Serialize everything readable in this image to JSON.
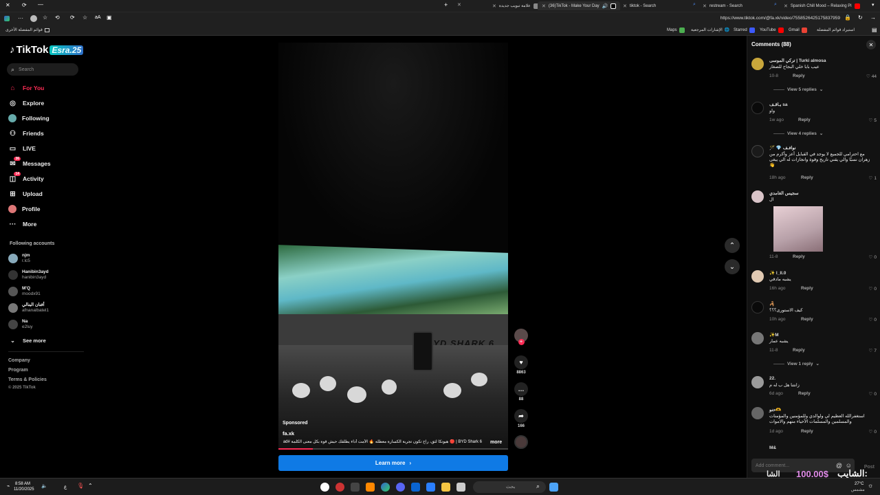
{
  "browser": {
    "tabs": [
      {
        "label": "Spanish Chill Mood – Relaxing Pl",
        "active": false
      },
      {
        "label": "restream - Search",
        "active": false
      },
      {
        "label": "tiktok - Search",
        "active": false
      },
      {
        "label": "(36)TikTok - Make Your Day",
        "active": true
      },
      {
        "label": "علامة تبويب جديدة",
        "active": false
      }
    ],
    "url": "https://www.tiktok.com/@fa.xk/video/7558526425175837959",
    "bookmarks": {
      "other": "قوائم المفضلة الأخرى",
      "import": "استيراد قوائم المفضلة",
      "gmail": "Gmail",
      "youtube": "YouTube",
      "starred": "Starred",
      "refs": "الإشارات المرجعية",
      "maps": "Maps"
    }
  },
  "sidebar": {
    "logo_text": "TikTok",
    "logo_badge": "Esra.25",
    "search_placeholder": "Search",
    "nav": [
      {
        "label": "For You",
        "icon": "home-icon",
        "active": true
      },
      {
        "label": "Explore",
        "icon": "compass-icon"
      },
      {
        "label": "Following",
        "icon": "following-icon"
      },
      {
        "label": "Friends",
        "icon": "friends-icon"
      },
      {
        "label": "LIVE",
        "icon": "live-icon"
      },
      {
        "label": "Messages",
        "icon": "messages-icon",
        "badge": "36"
      },
      {
        "label": "Activity",
        "icon": "activity-icon",
        "badge": "14"
      },
      {
        "label": "Upload",
        "icon": "upload-icon"
      },
      {
        "label": "Profile",
        "icon": "profile-icon"
      },
      {
        "label": "More",
        "icon": "more-icon"
      }
    ],
    "following_title": "Following accounts",
    "accounts": [
      {
        "name": "njm",
        "username": "r.lc5"
      },
      {
        "name": "Hanibin3ayd",
        "username": "hanibin3ayd"
      },
      {
        "name": "M'Q",
        "username": "moodx91"
      },
      {
        "name": "أفنان البنالي",
        "username": "afnanalbatel1"
      },
      {
        "name": "Na",
        "username": "e2luy"
      }
    ],
    "see_more": "See more",
    "footer": [
      "Company",
      "Program",
      "Terms & Policies",
      "© 2025 TikTok"
    ]
  },
  "video": {
    "sponsored": "Sponsored",
    "author": "fa.xk",
    "caption": "BYD Shark 6 | 🔴 هيونكا لثق، راح تكون تجربة الكسارة معطله 🔥 الأمت أداء يطلقك حيش قوة بكل معنى الكلمة #ad ...",
    "more": "more",
    "wall_brand": "BYD SHARK 6",
    "progress": 0.15,
    "likes": "8863",
    "comments": "88",
    "shares": "166",
    "learn_more": "Learn more"
  },
  "comments": {
    "title": "Comments (88)",
    "items": [
      {
        "user": "تركي الموسى | Turki almosa",
        "text": "عيب بابا خلي البجاح للصغار",
        "time": "10-8",
        "likes": "44",
        "view_replies": "View 5 replies"
      },
      {
        "user": "ﺑـﺎﻗـﻒ sa",
        "text": "واو",
        "time": "1w ago",
        "likes": "5",
        "view_replies": "View 4 replies"
      },
      {
        "user": "🪄 💎 نوافـف",
        "text": "مع احترامي للجميع لا يوجد في القبايل أعز وأكرم من زهران نسبًا والي يقني تاريخ وقوة وانجازات له الي يبغى 👋",
        "time": "18h ago",
        "likes": "1"
      },
      {
        "user": "سجيس الغامدي",
        "text": "ال",
        "time": "11-8",
        "likes": "0"
      },
      {
        "user": "✨ l_ll.0",
        "text": "يشبه مادقي",
        "time": "16h ago",
        "likes": "0"
      },
      {
        "user": "🦂",
        "text": "كيف الاستورى؟؟؟",
        "time": "10h ago",
        "likes": "0"
      },
      {
        "user": "✨M",
        "text": "يشبه عمار",
        "time": "11-8",
        "likes": "7",
        "view_replies": "View 1 reply"
      },
      {
        "user": "22.",
        "text": "زانتنا هل ب له م",
        "time": "6d ago",
        "likes": "0"
      },
      {
        "user": "حنو🫶",
        "text": "استغفرالله العظيم لي ولوالدي وللمؤمنين والمؤمنات والمسلمين والمسلمات الأحياء منهم والاموات",
        "time": "1d ago",
        "likes": "0"
      },
      {
        "user": "M&",
        "text": "",
        "time": "",
        "likes": ""
      }
    ],
    "reply_label": "Reply",
    "input_placeholder": "Add comment...",
    "post": "Post"
  },
  "overlay": {
    "price": "100.00$",
    "arabic_main": "الشايب:",
    "arabic_sub": "الشا"
  },
  "taskbar": {
    "time": "8:58 AM",
    "date": "11/20/2025",
    "weather": "27°C",
    "weather_sub": "مشمس",
    "search": "بحث",
    "lang": "ع"
  },
  "colors": {
    "accent": "#fe2c55",
    "learn": "#0f7ae5"
  }
}
